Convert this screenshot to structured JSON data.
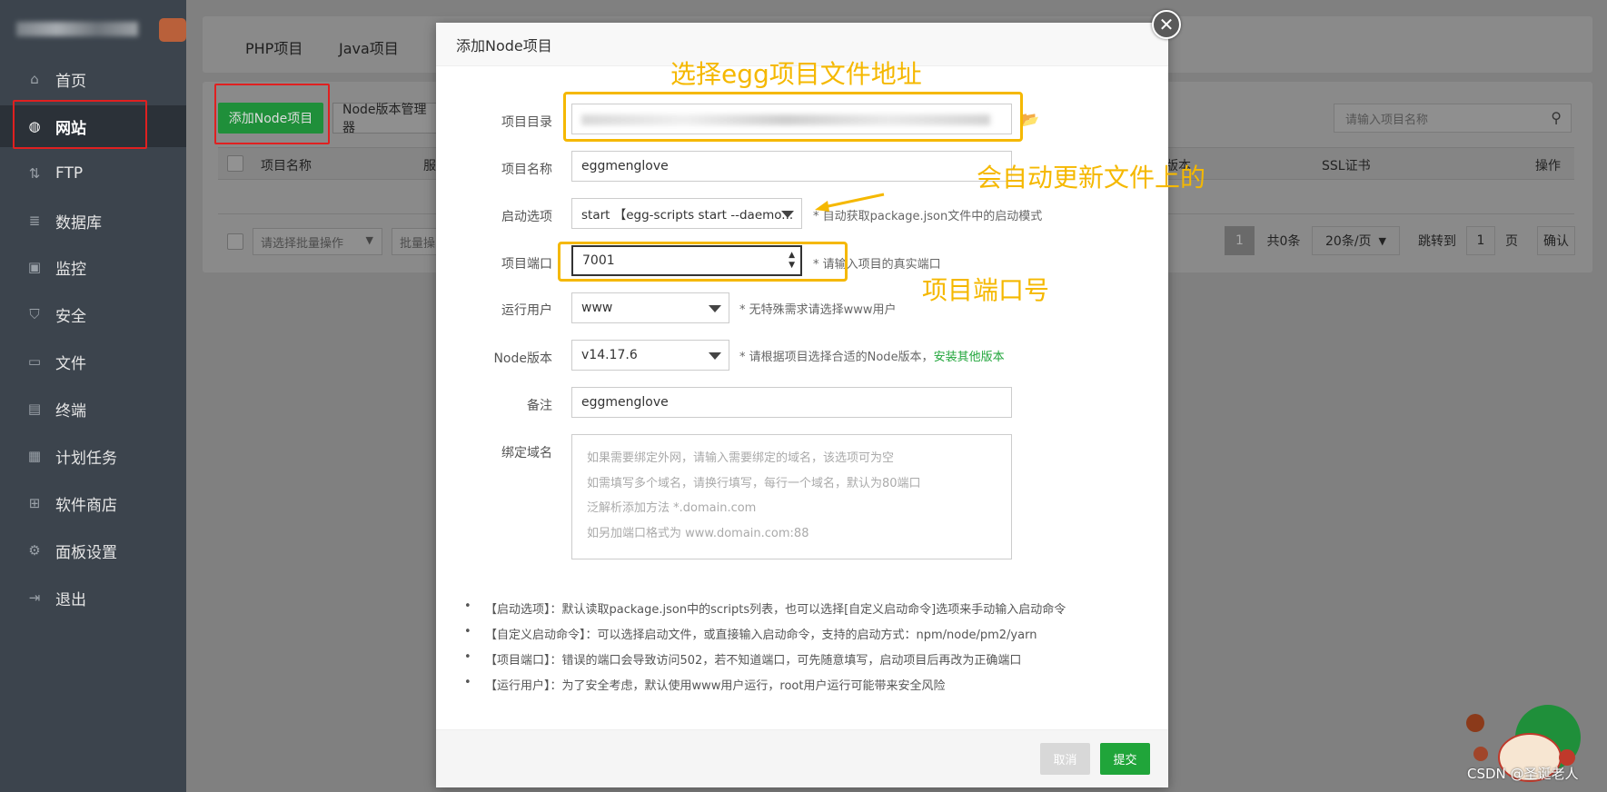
{
  "sidebar": {
    "items": [
      {
        "label": "首页",
        "icon": "home-icon"
      },
      {
        "label": "网站",
        "icon": "globe-icon"
      },
      {
        "label": "FTP",
        "icon": "ftp-icon"
      },
      {
        "label": "数据库",
        "icon": "database-icon"
      },
      {
        "label": "监控",
        "icon": "monitor-icon"
      },
      {
        "label": "安全",
        "icon": "shield-icon"
      },
      {
        "label": "文件",
        "icon": "folder-icon"
      },
      {
        "label": "终端",
        "icon": "terminal-icon"
      },
      {
        "label": "计划任务",
        "icon": "calendar-icon"
      },
      {
        "label": "软件商店",
        "icon": "grid-icon"
      },
      {
        "label": "面板设置",
        "icon": "gear-icon"
      },
      {
        "label": "退出",
        "icon": "logout-icon"
      }
    ]
  },
  "tabs": {
    "php": "PHP项目",
    "java": "Java项目"
  },
  "toolbar": {
    "add_node": "添加Node项目",
    "node_version_manager": "Node版本管理器",
    "search_placeholder": "请输入项目名称"
  },
  "table": {
    "col_name": "项目名称",
    "col_service": "服",
    "col_version": "版本",
    "col_ssl": "SSL证书",
    "col_actions": "操作"
  },
  "footer_bar": {
    "batch_placeholder": "请选择批量操作",
    "batch_btn": "批量操",
    "page": "1",
    "total": "共0条",
    "per_page": "20条/页",
    "jump_to": "跳转到",
    "jump_value": "1",
    "page_unit": "页",
    "confirm": "确认"
  },
  "modal": {
    "title": "添加Node项目",
    "fields": {
      "dir_label": "项目目录",
      "name_label": "项目名称",
      "name_value": "eggmenglove",
      "start_label": "启动选项",
      "start_value": "start 【egg-scripts start --daemo...",
      "start_hint": "* 自动获取package.json文件中的启动模式",
      "port_label": "项目端口",
      "port_value": "7001",
      "port_hint": "* 请输入项目的真实端口",
      "user_label": "运行用户",
      "user_value": "www",
      "user_hint": "* 无特殊需求请选择www用户",
      "node_label": "Node版本",
      "node_value": "v14.17.6",
      "node_hint": "* 请根据项目选择合适的Node版本，",
      "node_hint_link": "安装其他版本",
      "remark_label": "备注",
      "remark_value": "eggmenglove",
      "domain_label": "绑定域名",
      "domain_placeholder_1": "如果需要绑定外网，请输入需要绑定的域名，该选项可为空",
      "domain_placeholder_2": "如需填写多个域名，请换行填写，每行一个域名，默认为80端口",
      "domain_placeholder_3": "泛解析添加方法 *.domain.com",
      "domain_placeholder_4": "如另加端口格式为 www.domain.com:88"
    },
    "tips": [
      "【启动选项】：默认读取package.json中的scripts列表，也可以选择[自定义启动命令]选项来手动输入启动命令",
      "【自定义启动命令】：可以选择启动文件，或直接输入启动命令，支持的启动方式：npm/node/pm2/yarn",
      "【项目端口】：错误的端口会导致访问502，若不知道端口，可先随意填写，启动项目后再改为正确端口",
      "【运行用户】：为了安全考虑，默认使用www用户运行，root用户运行可能带来安全风险"
    ],
    "cancel": "取消",
    "submit": "提交"
  },
  "annotations": {
    "select_dir": "选择egg项目文件地址",
    "auto_update": "会自动更新文件上的",
    "port": "项目端口号"
  },
  "watermark": "CSDN @圣诞老人",
  "colors": {
    "accent_green": "#20a53a",
    "annotation_yellow": "#f5b800",
    "highlight_red": "#e02020"
  }
}
